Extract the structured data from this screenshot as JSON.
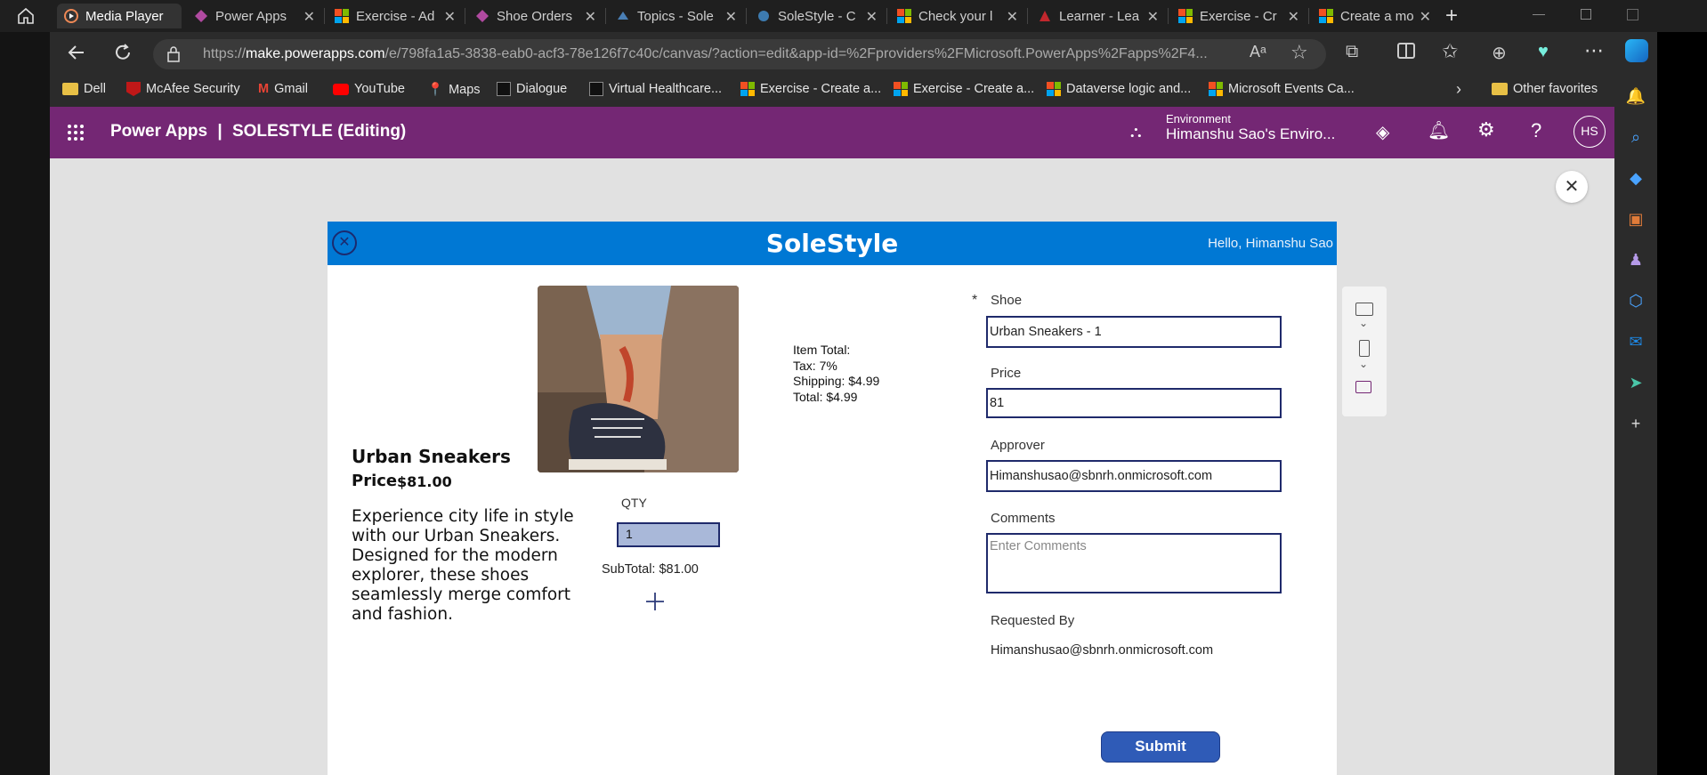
{
  "browser": {
    "tabs": [
      {
        "label": "Media Player",
        "active": true
      },
      {
        "label": "Power Apps"
      },
      {
        "label": "Exercise - Ad"
      },
      {
        "label": "Shoe Orders"
      },
      {
        "label": "Topics - Sole"
      },
      {
        "label": "SoleStyle - C"
      },
      {
        "label": "Check your l"
      },
      {
        "label": "Learner - Lea"
      },
      {
        "label": "Exercise - Cr"
      },
      {
        "label": "Create a mo"
      }
    ],
    "url_prefix": "https://",
    "url_host": "make.powerapps.com",
    "url_rest": "/e/798fa1a5-3838-eab0-acf3-78e126f7c40c/canvas/?action=edit&app-id=%2Fproviders%2FMicrosoft.PowerApps%2Fapps%2F4...",
    "bookmarks": [
      "Dell",
      "McAfee Security",
      "Gmail",
      "YouTube",
      "Maps",
      "Dialogue",
      "Virtual Healthcare...",
      "Exercise - Create a...",
      "Exercise - Create a...",
      "Dataverse logic and...",
      "Microsoft Events Ca..."
    ],
    "other_favorites": "Other favorites"
  },
  "powerapps": {
    "brand": "Power Apps",
    "divider": "|",
    "app_title": "SOLESTYLE (Editing)",
    "env_label": "Environment",
    "env_name": "Himanshu Sao's Enviro...",
    "avatar": "HS"
  },
  "app": {
    "title": "SoleStyle",
    "greeting": "Hello, Himanshu Sao",
    "product_name": "Urban Sneakers",
    "price_label": "Price",
    "price_value": "$81.00",
    "description": "Experience city life in style with our Urban Sneakers. Designed for the modern explorer, these shoes seamlessly merge comfort and fashion.",
    "qty_label": "QTY",
    "qty_value": "1",
    "subtotal": "SubTotal: $81.00",
    "item_total": "Item Total:",
    "tax": "Tax: 7%",
    "shipping": "Shipping: $4.99",
    "total": "Total: $4.99",
    "form": {
      "required_mark": "*",
      "shoe_label": "Shoe",
      "shoe_value": "Urban Sneakers - 1",
      "price_label": "Price",
      "price_value": "81",
      "approver_label": "Approver",
      "approver_value": "Himanshusao@sbnrh.onmicrosoft.com",
      "comments_label": "Comments",
      "comments_placeholder": "Enter Comments",
      "requested_by_label": "Requested By",
      "requested_by_value": "Himanshusao@sbnrh.onmicrosoft.com"
    },
    "submit_label": "Submit"
  },
  "colors": {
    "powerapps_purple": "#742774",
    "app_header_blue": "#0078d4",
    "submit_blue": "#2f5bb7",
    "field_border": "#1f2a6b"
  }
}
